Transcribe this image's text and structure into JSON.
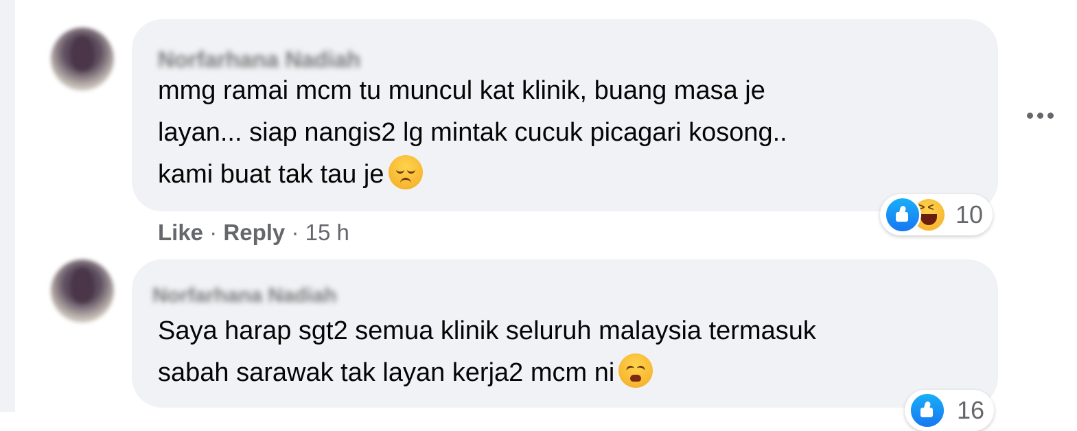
{
  "comments": [
    {
      "author": "Norfarhana Nadiah",
      "lines": [
        "mmg ramai mcm tu muncul kat klinik, buang masa je",
        "layan... siap nangis2 lg mintak cucuk picagari kosong..",
        "kami buat tak tau je"
      ],
      "emoji": "relieved-face",
      "actions": {
        "like": "Like",
        "reply": "Reply",
        "sep": "·",
        "time": "15 h"
      },
      "reactions": {
        "icons": [
          "like-reaction",
          "haha-reaction"
        ],
        "count": "10"
      }
    },
    {
      "author": "Norfarhana Nadiah",
      "lines": [
        "Saya harap sgt2 semua klinik seluruh malaysia termasuk",
        "sabah sarawak tak layan kerja2 mcm ni"
      ],
      "emoji": "weary-face",
      "reactions": {
        "icons": [
          "like-reaction"
        ],
        "count": "16"
      }
    }
  ]
}
